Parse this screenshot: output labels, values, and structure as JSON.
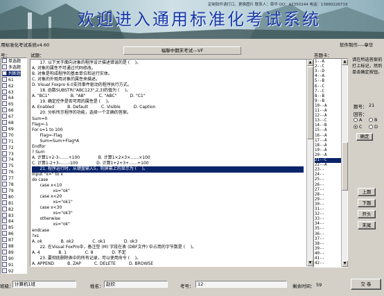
{
  "banner": {
    "title": "欢迎进入通用标准化考试系统",
    "info": "定制软件请打口、更换图片    联系人：章华  QQ：42350244  电话：13880226719"
  },
  "status": {
    "version": "用标准化考试系统v4.60",
    "author": "软件制作----章华",
    "tree_label": "号：",
    "content_label": "试题：",
    "answer_label": "答题卡：",
    "exam_title": "福聯中期末考试---VF"
  },
  "tree": {
    "items": [
      "单选题",
      "多选题",
      "判断题",
      "61",
      "62",
      "63",
      "64",
      "65",
      "66",
      "67",
      "68",
      "69",
      "70",
      "71",
      "72",
      "73",
      "74",
      "75",
      "76",
      "77",
      "78",
      "79",
      "80",
      "81",
      "82",
      "83",
      "84",
      "85",
      "86",
      "87",
      "88",
      "89",
      "90",
      "91",
      "92"
    ],
    "selected_index": 2
  },
  "questions": [
    "      17. 以下关于面向对象的程序设计描述错误的是 (    )。",
    "A. 对象的属性不可通过代码修改。",
    "B. 对象是构成程序的基本单位和运行实体。",
    "C. 对象的外观用对象的属性来描述。",
    "D. Visual Foxpro 6.0支持事件驱动的程序执行方式。",
    "      18. 函数SUBSTR(\"ABC123\",2,3)的值为 (    )。",
    "A. \"BC1\"                B. \"AB\"          C. \"ABC\"          D. \"C1\"",
    "      19. 确定控件是否可用的属性是 (    )。",
    "A. Enabled          B. Default          C. Visible          D. Caption",
    "      20. 分析所示程序的功能，选择一个正确的答案。",
    "Sum=0",
    "Flag=-1",
    "For s=1 to 100",
    "      Flag=-Flag",
    "      Sum=Sum+Flag*A",
    "Endfor",
    "? Sum",
    "A. 计算1+2-3-……+100              B. 计算1×2×3×……×100",
    "C. 计算1-2+3-……-100              D. 计算1+2+3+……+100",
    "      21. 程序运行时，从键盘输入5，则屏幕上的显示为 (    )。",
    "Input \"x=\" to x",
    "do case",
    "      case x<10",
    "                xs=\"ok\"",
    "      case x<20",
    "                xs=\"ok1\"",
    "      case x<30",
    "                xs=\"ok3\"",
    "      otherwise",
    "                xs=\"ok\"",
    "endcase",
    "?xs",
    "A. ok              B. ok2              C. ok1              D. ok3",
    "      22. 在Visual FoxPro中，备注型 (M) 字段在表 (DBF文件) 中占用的字节数是 (    )。",
    "A. 4              B. 1              C. 8              D. 不定",
    "      23. 要彻底删除表中的所有记录，可以使用命令 (    )。",
    "A. APPEND          B. ZAP          C. DELETE          D. BROWSE"
  ],
  "highlight_index": 19,
  "answers": {
    "items": [
      "1--A",
      "2--C",
      "3--D",
      "4--A",
      "5--B",
      "6--C",
      "7--C",
      "8--B",
      "9--B",
      "10--A",
      "11--A",
      "12--A",
      "13--C",
      "14--B",
      "15--A",
      "16--A",
      "17--A",
      "18--A",
      "19--A",
      "20--A",
      "21--C",
      "22--A",
      "23--",
      "24--",
      "25--",
      "26--",
      "27--",
      "28--",
      "29--",
      "30--",
      "31--",
      "32--",
      "33--",
      "34--",
      "35--",
      "36--",
      "37--",
      "38--",
      "39--",
      "40--",
      "41--",
      "42--"
    ],
    "selected_index": 20
  },
  "right": {
    "instruction": "请在所选答案前打上标记，然后单击确定按钮。",
    "qno_label": "题号：",
    "qno_value": "21",
    "answer_label": "回答：",
    "options": [
      {
        "label": "A",
        "checked": false
      },
      {
        "label": "B",
        "checked": false
      },
      {
        "label": "C",
        "checked": true
      },
      {
        "label": "D",
        "checked": false
      }
    ],
    "confirm": "确定",
    "prev": "上题",
    "next": "下题",
    "first": "开头",
    "last": "末尾"
  },
  "bottom": {
    "class_label": "班级：",
    "class_value": "计算机1班",
    "name_label": "姓名：",
    "name_value": "赵欣",
    "examno_label": "考号：",
    "examno_value": "12",
    "time_label": "剩余时间：",
    "time_value": "59",
    "submit": "交  卷"
  }
}
